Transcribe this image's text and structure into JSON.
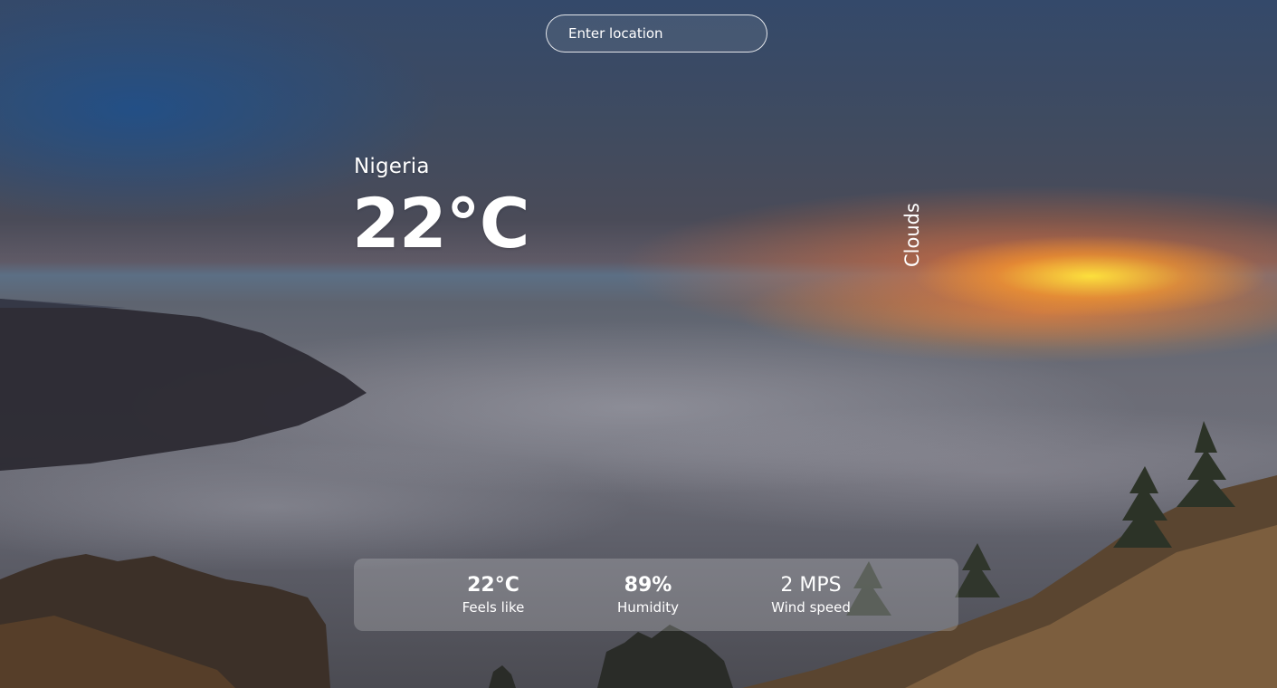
{
  "search": {
    "placeholder": "Enter location",
    "value": ""
  },
  "weather": {
    "location": "Nigeria",
    "temperature": "22°C",
    "condition": "Clouds"
  },
  "details": [
    {
      "value": "22°C",
      "label": "Feels like"
    },
    {
      "value": "89%",
      "label": "Humidity"
    },
    {
      "value": "2 MPS",
      "label": "Wind speed"
    }
  ]
}
